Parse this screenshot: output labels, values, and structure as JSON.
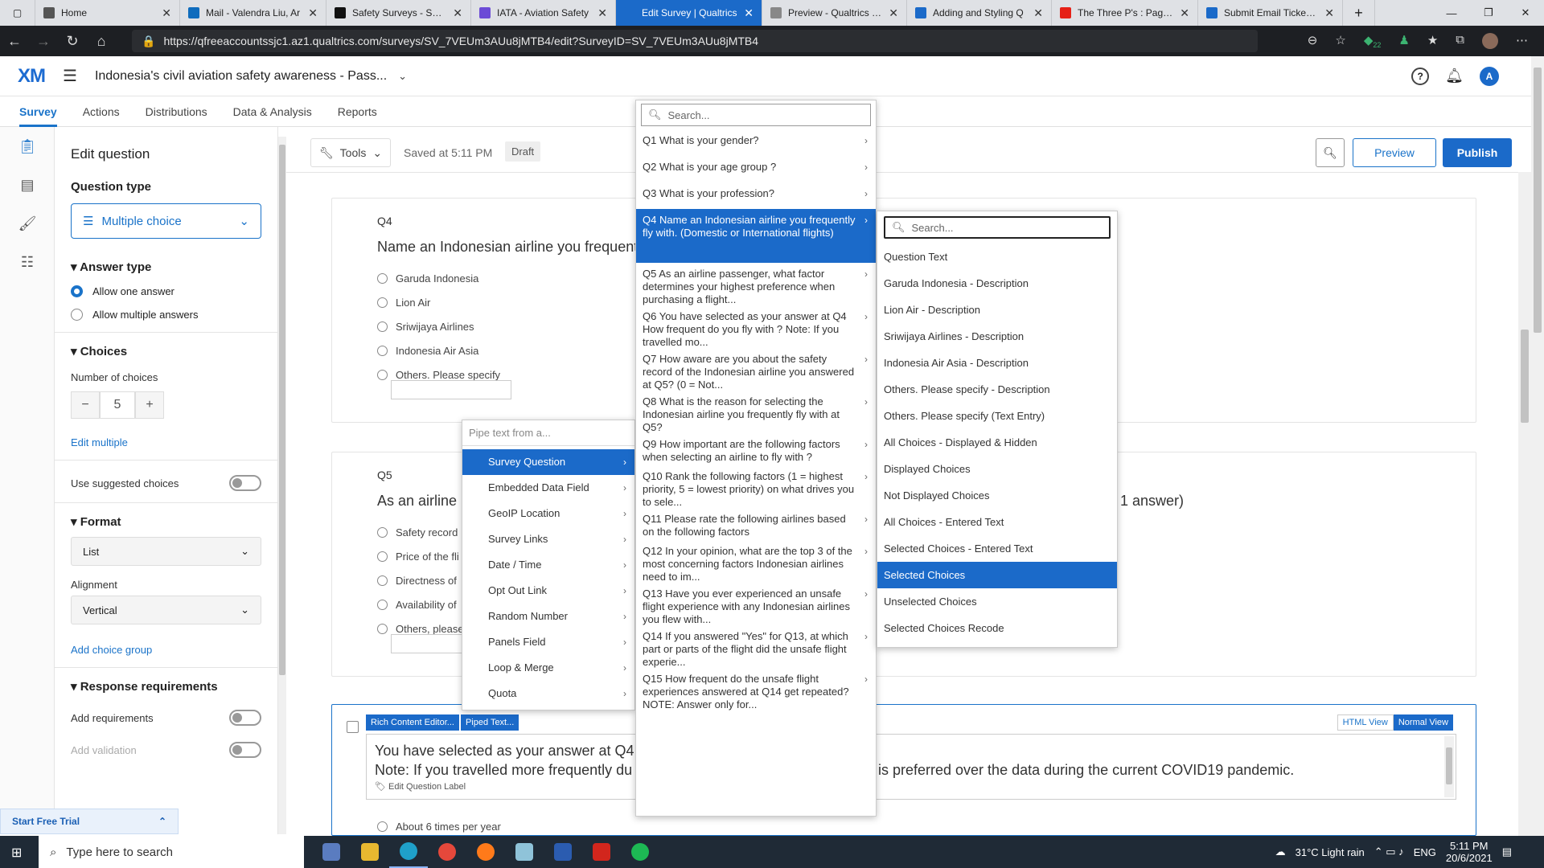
{
  "browser": {
    "tabs": [
      {
        "title": "Home",
        "icon": "page-icon",
        "color": "#555"
      },
      {
        "title": "Mail - Valendra Liu, Ar",
        "icon": "outlook-icon",
        "color": "#0f6cbd"
      },
      {
        "title": "Safety Surveys - SKYb",
        "icon": "skybrary-icon",
        "color": "#111"
      },
      {
        "title": "IATA - Aviation Safety",
        "icon": "iata-icon",
        "color": "#6b4bd6"
      },
      {
        "title": "Edit Survey | Qualtrics",
        "icon": "xm-icon",
        "color": "#1b6ac9"
      },
      {
        "title": "Preview - Qualtrics Su",
        "icon": "xm-icon",
        "color": "#888"
      },
      {
        "title": "Adding and Styling Q",
        "icon": "xm-icon",
        "color": "#1b6ac9"
      },
      {
        "title": "The Three P's : Page B",
        "icon": "youtube-icon",
        "color": "#e62117"
      },
      {
        "title": "Submit Email Ticket | C",
        "icon": "xm-icon",
        "color": "#1b6ac9"
      }
    ],
    "url": "https://qfreeaccountssjc1.az1.qualtrics.com/surveys/SV_7VEUm3AUu8jMTB4/edit?SurveyID=SV_7VEUm3AUu8jMTB4",
    "extension_badge": "22"
  },
  "app": {
    "logo": "XM",
    "survey_title": "Indonesia's civil aviation safety awareness - Pass...",
    "avatar": "A",
    "nav_tabs": [
      "Survey",
      "Actions",
      "Distributions",
      "Data & Analysis",
      "Reports"
    ]
  },
  "toolbar": {
    "tools": "Tools",
    "saved": "Saved at 5:11 PM",
    "status": "Draft",
    "preview": "Preview",
    "publish": "Publish"
  },
  "left_panel": {
    "title": "Edit question",
    "question_type_label": "Question type",
    "question_type": "Multiple choice",
    "answer_type_label": "Answer type",
    "allow_one": "Allow one answer",
    "allow_multiple": "Allow multiple answers",
    "choices_label": "Choices",
    "number_of_choices_label": "Number of choices",
    "number_of_choices": "5",
    "minus": "−",
    "plus": "+",
    "edit_multiple": "Edit multiple",
    "use_suggested": "Use suggested choices",
    "format_label": "Format",
    "format_value": "List",
    "alignment_label": "Alignment",
    "alignment_value": "Vertical",
    "add_choice_group": "Add choice group",
    "response_req": "Response requirements",
    "add_requirements": "Add requirements",
    "add_validation": "Add validation",
    "start_trial": "Start Free Trial"
  },
  "q4": {
    "num": "Q4",
    "text": "Name an Indonesian airline you frequent",
    "choices": [
      "Garuda Indonesia",
      "Lion Air",
      "Sriwijaya Airlines",
      "Indonesia Air Asia",
      "Others. Please specify"
    ]
  },
  "q5": {
    "num": "Q5",
    "text": "As an airline",
    "suffix": "1 answer)",
    "choices": [
      "Safety record",
      "Price of the fli",
      "Directness of",
      "Availability of",
      "Others, please"
    ]
  },
  "q6": {
    "rich_editor": "Rich Content Editor...",
    "piped_text": "Piped Text...",
    "html_view": "HTML View",
    "normal_view": "Normal View",
    "line1": "You have selected  as your answer at Q4",
    "line2a": "Note: If you travelled more frequently du",
    "line2b": "is preferred over the data during the current COVID19 pandemic.",
    "edit_label": "Edit Question Label",
    "choice": "About 6 times per year"
  },
  "pipe_menu": {
    "placeholder": "Pipe text from a...",
    "items": [
      "Survey Question",
      "Embedded Data Field",
      "GeoIP Location",
      "Survey Links",
      "Date / Time",
      "Opt Out Link",
      "Random Number",
      "Panels Field",
      "Loop & Merge",
      "Quota"
    ]
  },
  "question_menu": {
    "search": "Search...",
    "items": [
      "Q1 What is your gender?",
      "Q2 What is your age group ?",
      "Q3 What is your profession?",
      "Q4 Name an Indonesian airline you frequently fly with. (Domestic or International flights)",
      "Q5 As an airline passenger, what factor determines your highest preference when purchasing a flight...",
      "Q6 You have selected  as your answer at Q4 How frequent do you fly with ? Note: If you travelled mo...",
      "Q7 How aware are you about the safety record of the Indonesian airline you answered at Q5? (0 = Not...",
      "Q8 What is the reason for selecting the Indonesian airline you frequently fly with at Q5?",
      "Q9 How important are the following factors when selecting an airline to fly with ?",
      "Q10 Rank the following factors (1 = highest priority, 5 = lowest priority) on what drives you to sele...",
      "Q11 Please rate the following airlines based on the following factors",
      "Q12 In your opinion, what are the top 3 of the most concerning factors Indonesian airlines need to im...",
      "Q13 Have you ever experienced an unsafe flight experience with any Indonesian airlines you flew with...",
      "Q14 If you answered \"Yes\" for Q13, at which part or parts of the flight did the unsafe flight experie...",
      "Q15 How frequent do the unsafe flight experiences answered at Q14 get repeated? NOTE: Answer only for..."
    ]
  },
  "field_menu": {
    "search": "Search...",
    "items": [
      "Question Text",
      "Garuda Indonesia - Description",
      "Lion Air - Description",
      "Sriwijaya Airlines - Description",
      "Indonesia Air Asia - Description",
      "Others. Please specify - Description",
      "Others. Please specify (Text Entry)",
      "All Choices - Displayed & Hidden",
      "Displayed Choices",
      "Not Displayed Choices",
      "All Choices - Entered Text",
      "Selected Choices - Entered Text",
      "Selected Choices",
      "Unselected Choices",
      "Selected Choices Recode"
    ]
  },
  "taskbar": {
    "search": "Type here to search",
    "weather": "31°C  Light rain",
    "lang": "ENG",
    "time": "5:11 PM",
    "date": "20/6/2021"
  }
}
